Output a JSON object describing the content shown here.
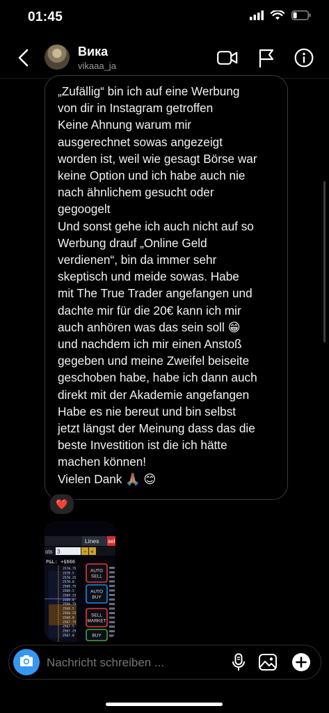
{
  "status_bar": {
    "time": "01:45",
    "battery_level": 0.25
  },
  "header": {
    "name": "Вика",
    "handle": "vikaaa_ja",
    "icons": [
      "back-arrow-icon",
      "video-call-icon",
      "flag-icon",
      "info-icon"
    ]
  },
  "message": {
    "lines": [
      "„Zufällig“ bin ich auf eine Werbung",
      "von dir in Instagram getroffen",
      "Keine Ahnung warum mir",
      "ausgerechnet sowas angezeigt",
      "worden ist, weil wie gesagt Börse war",
      "keine Option und ich habe auch nie",
      "nach ähnlichem gesucht oder",
      "gegoogelt",
      "Und sonst gehe ich auch nicht auf so",
      "Werbung drauf „Online Geld",
      "verdienen“, bin da immer sehr",
      "skeptisch und meide sowas. Habe",
      "mit The True Trader angefangen und",
      "dachte mir für die 20€ kann ich mir",
      "auch anhören was das sein soll 😁",
      "und nachdem ich mir einen Anstoß",
      "gegeben und meine Zweifel beiseite",
      "geschoben habe, habe ich dann auch",
      "direkt mit der Akademie angefangen",
      "Habe es nie bereut und bin selbst",
      "jetzt längst der Meinung dass das die",
      "beste Investition ist die ich hätte",
      "machen können!",
      "Vielen Dank 🙏🏽 😊"
    ],
    "reaction": "❤️"
  },
  "photo": {
    "tab_lines": "Lines",
    "tab_sel": "sel",
    "lots_label": "ots",
    "lots_value": "3",
    "pl_label": "P&L: +$666",
    "prices": [
      "2570.75",
      "2570.5",
      "2570.25",
      "2570.0",
      "2569.75",
      "2569.5",
      "2569.25",
      "2569.0",
      "2568.75",
      "2568.5",
      "2568.25",
      "2568.0",
      "2567.75",
      "2567.5",
      "2567.25",
      "2567.0"
    ],
    "buttons": [
      {
        "label": "AUTO\nSELL",
        "color": "#e53935"
      },
      {
        "label": "AUTO\nBUY",
        "color": "#1e88e5"
      },
      {
        "label": "SELL\nMARKET",
        "color": "#e53935"
      },
      {
        "label": "BUY",
        "color": "#43a047"
      }
    ]
  },
  "composer": {
    "placeholder": "Nachricht schreiben ...",
    "icons": [
      "camera-icon",
      "microphone-icon",
      "gallery-icon",
      "plus-icon"
    ]
  },
  "colors": {
    "accent": "#3797f0",
    "background": "#000000",
    "bubble_border": "#3a3a3a"
  }
}
